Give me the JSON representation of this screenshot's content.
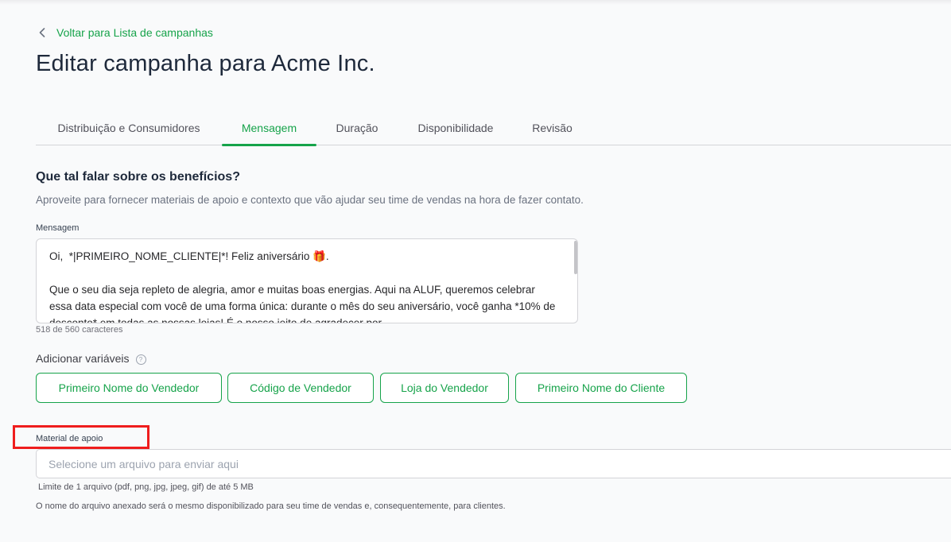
{
  "header": {
    "back_label": "Voltar para Lista de campanhas",
    "title": "Editar campanha para Acme Inc."
  },
  "tabs": [
    {
      "label": "Distribuição e Consumidores",
      "active": false
    },
    {
      "label": "Mensagem",
      "active": true
    },
    {
      "label": "Duração",
      "active": false
    },
    {
      "label": "Disponibilidade",
      "active": false
    },
    {
      "label": "Revisão",
      "active": false
    }
  ],
  "section": {
    "title": "Que tal falar sobre os benefícios?",
    "description": "Aproveite para fornecer materiais de apoio e contexto que vão ajudar seu time de vendas na hora de fazer contato."
  },
  "message": {
    "label": "Mensagem",
    "text": "Oi,  *|PRIMEIRO_NOME_CLIENTE|*! Feliz aniversário 🎁.\n\nQue o seu dia seja repleto de alegria, amor e muitas boas energias. Aqui na ALUF, queremos celebrar essa data especial com você de uma forma única: durante o mês do seu aniversário, você ganha *10% de desconto* em todas as nossas lojas! É o nosso jeito de agradecer por",
    "counter": "518 de 560 caracteres"
  },
  "variables": {
    "label": "Adicionar variáveis",
    "help_glyph": "?",
    "buttons": [
      "Primeiro Nome do Vendedor",
      "Código de Vendedor",
      "Loja do Vendedor",
      "Primeiro Nome do Cliente"
    ]
  },
  "support": {
    "label": "Material de apoio",
    "placeholder": "Selecione um arquivo para enviar aqui",
    "limit_hint": "Limite de 1 arquivo (pdf, png, jpg, jpeg, gif) de até 5 MB",
    "note": "O nome do arquivo anexado será o mesmo disponibilizado para seu time de vendas e, consequentemente, para clientes."
  },
  "colors": {
    "accent": "#16a34a",
    "highlight": "#ef1d1d"
  }
}
